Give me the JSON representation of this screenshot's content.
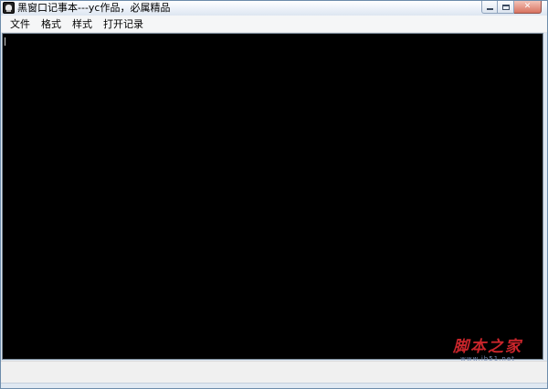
{
  "window": {
    "title": "黑窗口记事本---yc作品，必属精品",
    "icon": "skull-app-icon"
  },
  "caption_buttons": {
    "minimize_icon": "minimize-icon",
    "maximize_icon": "maximize-icon",
    "close_glyph": "✕"
  },
  "menubar": {
    "items": [
      {
        "label": "文件"
      },
      {
        "label": "格式"
      },
      {
        "label": "样式"
      },
      {
        "label": "打开记录"
      }
    ]
  },
  "editor": {
    "text": "",
    "background": "#000000",
    "caret_color": "#d0d0d0"
  },
  "watermark": {
    "main": "脚本之家",
    "sub": "www.jb51.net",
    "color": "#c9252b"
  }
}
